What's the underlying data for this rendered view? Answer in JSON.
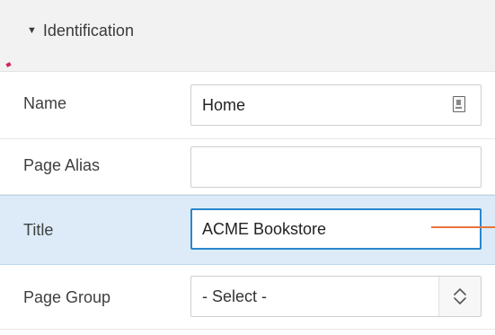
{
  "section": {
    "toggle_icon": "triangle-down-icon",
    "title": "Identification"
  },
  "fields": {
    "name": {
      "label": "Name",
      "value": "Home",
      "button_icon": "popup-lov-icon"
    },
    "page_alias": {
      "label": "Page Alias",
      "value": ""
    },
    "title": {
      "label": "Title",
      "value": "ACME Bookstore"
    },
    "page_group": {
      "label": "Page Group",
      "selected": "- Select -",
      "arrow_icon": "chevron-up-down-icon"
    }
  },
  "colors": {
    "header_bg": "#f2f2f2",
    "active_row_bg": "#dcebf7",
    "focus_border": "#2a86cc",
    "callout": "#e8753a",
    "accent_mark": "#d0265a"
  }
}
